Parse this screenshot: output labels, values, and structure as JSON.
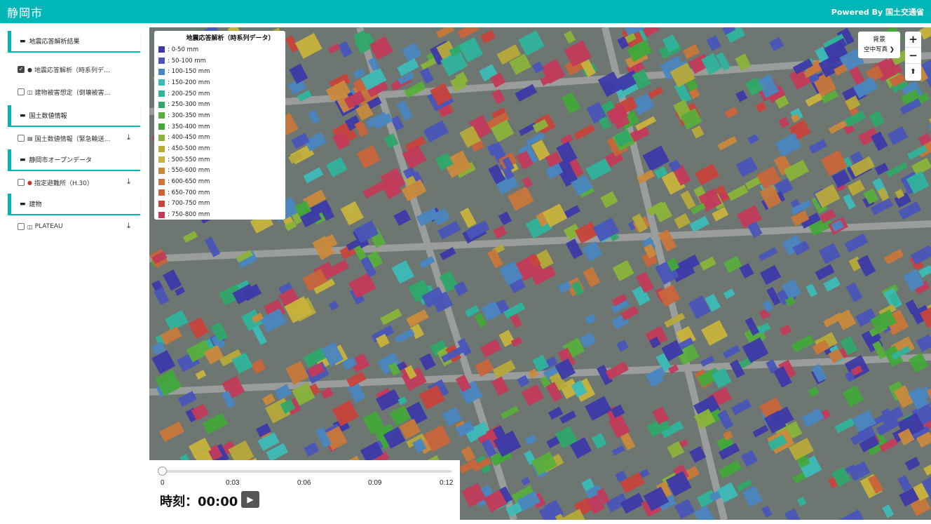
{
  "app": {
    "title": "静岡市",
    "powered_by": "Powered By 国土交通省"
  },
  "sidebar": {
    "categories": [
      {
        "label": "地震応答解析結果",
        "items": [
          {
            "label": "地震応答解析（時系列デ…",
            "checked": true,
            "mark": "●",
            "download": false
          },
          {
            "label": "建物被害想定（倒壊被害…",
            "checked": false,
            "mark": "◫",
            "download": false
          }
        ]
      },
      {
        "label": "国土数値情報",
        "items": [
          {
            "label": "国土数値情報（緊急輸送…",
            "checked": false,
            "mark": "▤",
            "download": true
          }
        ]
      },
      {
        "label": "静岡市オープンデータ",
        "items": [
          {
            "label": "指定避難所（H.30）",
            "checked": false,
            "mark": "●",
            "download": true
          }
        ]
      },
      {
        "label": "建物",
        "items": [
          {
            "label": "PLATEAU",
            "checked": false,
            "mark": "◫",
            "download": true
          }
        ]
      }
    ],
    "folder_icon": "folder-icon",
    "download_icon": "download-icon",
    "download_glyph": "⤓"
  },
  "legend": {
    "title": "地震応答解析（時系列データ）",
    "entries": [
      {
        "label": ": 0-50 mm",
        "color": "#3d3aa8"
      },
      {
        "label": ": 50-100 mm",
        "color": "#4a55b8"
      },
      {
        "label": ": 100-150 mm",
        "color": "#4a86c0"
      },
      {
        "label": ": 150-200 mm",
        "color": "#3cbab8"
      },
      {
        "label": ": 200-250 mm",
        "color": "#2fb39b"
      },
      {
        "label": ": 250-300 mm",
        "color": "#2fa86a"
      },
      {
        "label": ": 300-350 mm",
        "color": "#5aae3c"
      },
      {
        "label": ": 350-400 mm",
        "color": "#43a83a"
      },
      {
        "label": ": 400-450 mm",
        "color": "#8ab33a"
      },
      {
        "label": ": 450-500 mm",
        "color": "#b7a93a"
      },
      {
        "label": ": 500-550 mm",
        "color": "#c8b33c"
      },
      {
        "label": ": 550-600 mm",
        "color": "#c98a3c"
      },
      {
        "label": ": 600-650 mm",
        "color": "#c9773a"
      },
      {
        "label": ": 650-700 mm",
        "color": "#c8643a"
      },
      {
        "label": ": 700-750 mm",
        "color": "#c8433b"
      },
      {
        "label": ": 750-800 mm",
        "color": "#c23a5a"
      }
    ]
  },
  "map_controls": {
    "background_label": "背景",
    "background_value": "空中写真 ❯",
    "zoom_in": "+",
    "zoom_out": "−",
    "compass": "⬆"
  },
  "timeline": {
    "ticks": [
      "0",
      "0:03",
      "0:06",
      "0:09",
      "0:12"
    ],
    "time_label": "時刻：00:00",
    "play": "▶",
    "progress": 0
  }
}
